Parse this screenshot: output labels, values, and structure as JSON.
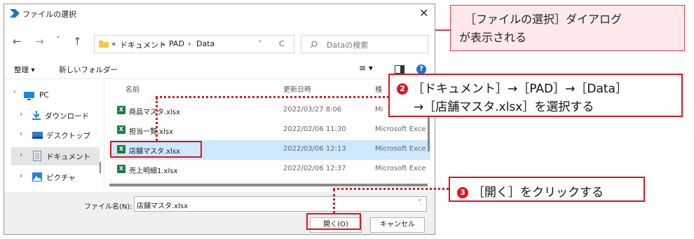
{
  "dialog": {
    "title": "ファイルの選択",
    "close_glyph": "✕",
    "nav": {
      "back": "←",
      "forward": "→",
      "recent": "˅",
      "up": "↑"
    },
    "address": {
      "overflow": "«",
      "path": [
        "ドキュメント",
        "PAD",
        "Data"
      ],
      "separator": "›",
      "refresh": "C",
      "dropdown": "˅"
    },
    "search": {
      "placeholder": "Dataの検索"
    },
    "toolbar": {
      "organize": "整理 ▾",
      "new_folder": "新しいフォルダー",
      "view": "≡ ▾",
      "help": "?"
    },
    "sidebar": [
      {
        "label": "PC",
        "expand": "˅",
        "icon": "pc-icon"
      },
      {
        "label": "ダウンロード",
        "expand": "›",
        "icon": "download-icon"
      },
      {
        "label": "デスクトップ",
        "expand": "›",
        "icon": "desktop-icon"
      },
      {
        "label": "ドキュメント",
        "expand": "›",
        "icon": "document-icon",
        "selected": true
      },
      {
        "label": "ピクチャ",
        "expand": "›",
        "icon": "picture-icon"
      }
    ],
    "columns": {
      "name": "名前",
      "modified": "更新日時",
      "type": "種"
    },
    "files": [
      {
        "name": "商品マスタ.xlsx",
        "date": "2022/03/27 8:06",
        "type": "Mi"
      },
      {
        "name": "担当一覧.xlsx",
        "date": "2022/02/06 11:30",
        "type": "Microsoft Exce"
      },
      {
        "name": "店舗マスタ.xlsx",
        "date": "2022/03/06 12:13",
        "type": "Microsoft Exce",
        "selected": true
      },
      {
        "name": "売上明細1.xlsx",
        "date": "2022/02/06 12:37",
        "type": "Microsoft Exce"
      }
    ],
    "xl_glyph": "X",
    "filename_label": "ファイル名(N):",
    "filename_value": "店舗マスタ.xlsx",
    "open_button": "開く(O)",
    "cancel_button": "キャンセル"
  },
  "annotations": {
    "callout1": {
      "line1": "［ファイルの選択］ダイアログ",
      "line2": "が表示される"
    },
    "callout2": {
      "num": "2",
      "line1": "［ドキュメント］→［PAD］→［Data］",
      "line2": "→［店舗マスタ.xlsx］を選択する"
    },
    "callout3": {
      "num": "3",
      "text": "［開く］をクリックする"
    }
  },
  "colors": {
    "accent_red": "#e0141e",
    "callout_fill": "#fde8ea",
    "selection": "#cde8ff",
    "excel_green": "#1d7a45"
  }
}
